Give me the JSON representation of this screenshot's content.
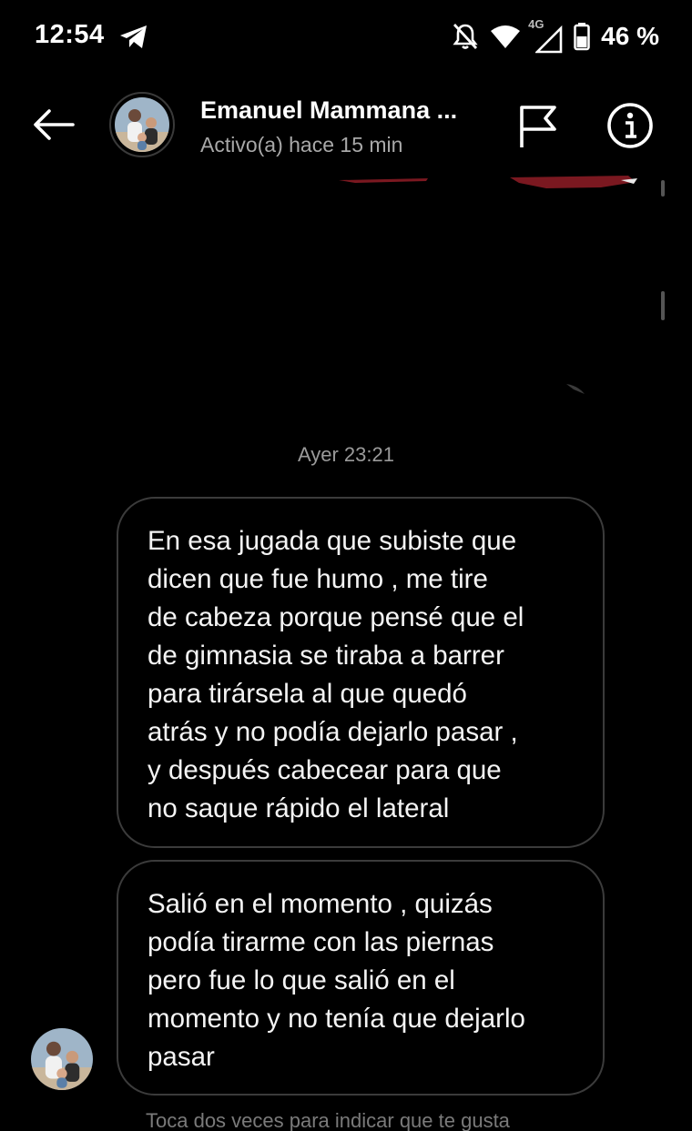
{
  "status_bar": {
    "time": "12:54",
    "network": "4G",
    "battery": "46 %",
    "icons": [
      "telegram-icon",
      "mute-icon",
      "wifi-icon",
      "signal-icon",
      "battery-icon"
    ]
  },
  "header": {
    "contact_name": "Emanuel Mammana ...",
    "contact_status": "Activo(a) hace 15 min",
    "icons": [
      "back-arrow-icon",
      "flag-icon",
      "info-icon"
    ]
  },
  "conversation": {
    "timestamp": "Ayer 23:21",
    "messages": [
      {
        "lines": [
          "En esa jugada que subiste que",
          "dicen que fue humo , me tire",
          "de cabeza porque pensé que el",
          "de gimnasia se tiraba a barrer",
          "para tirársela al que quedó",
          "atrás y no podía dejarlo pasar ,",
          "y después cabecear para que",
          "no saque rápido el lateral"
        ]
      },
      {
        "lines": [
          "Salió en el momento , quizás",
          "podía tirarme con las piernas",
          "pero fue lo que salió en el",
          "momento y no tenía que dejarlo",
          "pasar"
        ]
      }
    ],
    "hint": "Toca dos veces para indicar que te gusta"
  },
  "colors": {
    "background": "#000000",
    "bubble_border": "#3b3b3b",
    "secondary_text": "#a8a8a8",
    "media_accent": "#7a1820"
  }
}
